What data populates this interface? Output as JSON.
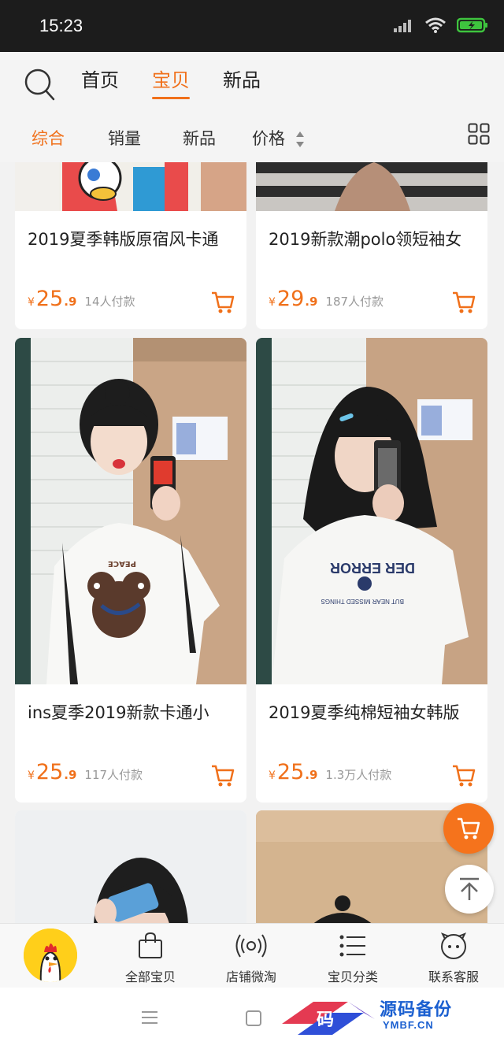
{
  "status_bar": {
    "time": "15:23"
  },
  "header": {
    "tabs": [
      {
        "label": "首页",
        "active": false
      },
      {
        "label": "宝贝",
        "active": true
      },
      {
        "label": "新品",
        "active": false
      }
    ]
  },
  "sort_bar": {
    "items": [
      "综合",
      "销量",
      "新品",
      "价格"
    ],
    "active": "综合"
  },
  "products": [
    {
      "title": "2019夏季韩版原宿风卡通",
      "price_symbol": "¥",
      "price_int": "25",
      "price_dec": ".9",
      "sold": "14人付款"
    },
    {
      "title": "2019新款潮polo领短袖女",
      "price_symbol": "¥",
      "price_int": "29",
      "price_dec": ".9",
      "sold": "187人付款"
    },
    {
      "title": "ins夏季2019新款卡通小",
      "price_symbol": "¥",
      "price_int": "25",
      "price_dec": ".9",
      "sold": "117人付款"
    },
    {
      "title": "2019夏季纯棉短袖女韩版",
      "price_symbol": "¥",
      "price_int": "25",
      "price_dec": ".9",
      "sold": "1.3万人付款"
    }
  ],
  "shirt_prints": {
    "left": "PEACE",
    "right_main": "DER ERROR",
    "right_sub": "BUT NEAR MISSED THINGS"
  },
  "bottom_nav": [
    {
      "label": "全部宝贝",
      "icon": "bag-icon"
    },
    {
      "label": "店铺微淘",
      "icon": "broadcast-icon"
    },
    {
      "label": "宝贝分类",
      "icon": "list-icon"
    },
    {
      "label": "联系客服",
      "icon": "chat-face-icon"
    }
  ],
  "watermark": {
    "glyph": "码",
    "main": "源码备份",
    "sub": "YMBF.CN"
  },
  "colors": {
    "accent": "#f0701a",
    "fab": "#f5731c"
  }
}
